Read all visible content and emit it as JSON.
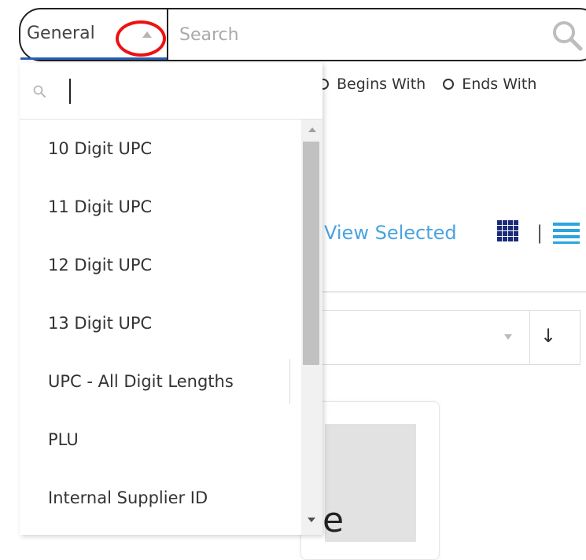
{
  "search": {
    "category": "General",
    "placeholder": "Search"
  },
  "match_options": [
    "Begins With",
    "Ends With"
  ],
  "view": {
    "selected_label": "View Selected",
    "separator": "|"
  },
  "sort": {
    "arrow": "↓"
  },
  "product_fragment": "e",
  "dropdown": {
    "options": [
      "10 Digit UPC",
      "11 Digit UPC",
      "12 Digit UPC",
      "13 Digit UPC",
      "UPC - All Digit Lengths",
      "PLU",
      "Internal Supplier ID"
    ]
  },
  "colors": {
    "accent_link": "#4aa3e0",
    "grid_icon": "#1b2b7a",
    "list_icon": "#2aa5e0",
    "underline": "#2b5fb3",
    "highlight_circle": "#ee1111"
  },
  "icons": {
    "search": "magnifier-icon",
    "grid": "grid-view-icon",
    "list": "list-view-icon"
  }
}
